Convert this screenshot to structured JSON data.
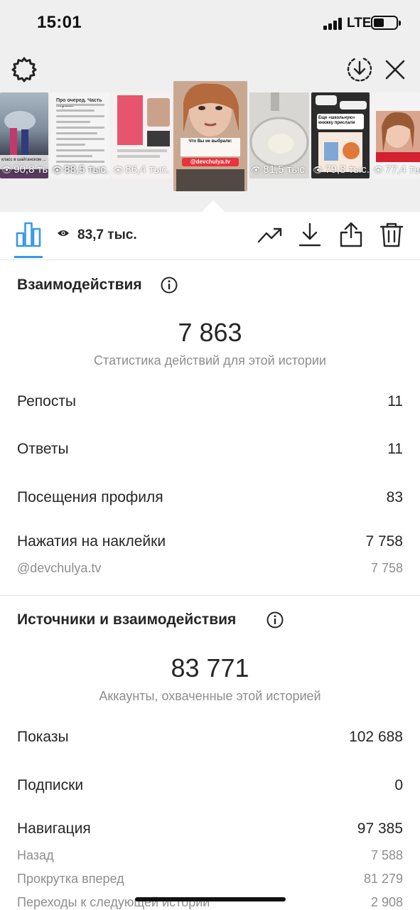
{
  "status_bar": {
    "time": "15:01",
    "network": "LTE"
  },
  "thumbnails": [
    {
      "views": "90,8 тыс.",
      "caption": "класс в шайтанском ...",
      "selected": false
    },
    {
      "views": "88,5 тыс.",
      "caption": "Про очеред. Часть первая",
      "selected": false
    },
    {
      "views": "86,4 тыс.",
      "caption": "",
      "selected": false
    },
    {
      "views": "83,7 тыс.",
      "caption": "Что Вы не выбрали:",
      "handle": "@devchulya.tv",
      "selected": true
    },
    {
      "views": "81,5 тыс.",
      "caption": "",
      "selected": false
    },
    {
      "views": "79,8 тыс.",
      "caption": "Еще «школьную» книжку прислали",
      "selected": false
    },
    {
      "views": "77,4 тыс.",
      "caption": "",
      "selected": false
    }
  ],
  "toolbar": {
    "view_count": "83,7 тыс."
  },
  "interactions": {
    "title": "Взаимодействия",
    "total": "7 863",
    "caption": "Статистика действий для этой истории",
    "rows": [
      {
        "label": "Репосты",
        "value": "11"
      },
      {
        "label": "Ответы",
        "value": "11"
      },
      {
        "label": "Посещения профиля",
        "value": "83"
      },
      {
        "label": "Нажатия на наклейки",
        "value": "7 758"
      }
    ],
    "sub_rows": [
      {
        "label": "@devchulya.tv",
        "value": "7 758"
      }
    ]
  },
  "discovery": {
    "title": "Источники и взаимодействия",
    "total": "83 771",
    "caption": "Аккаунты, охваченные этой историей",
    "rows": [
      {
        "label": "Показы",
        "value": "102 688"
      },
      {
        "label": "Подписки",
        "value": "0"
      },
      {
        "label": "Навигация",
        "value": "97 385"
      }
    ],
    "sub_rows": [
      {
        "label": "Назад",
        "value": "7 588"
      },
      {
        "label": "Прокрутка вперед",
        "value": "81 279"
      },
      {
        "label": "Переходы к следующей истории",
        "value": "2 908"
      }
    ]
  },
  "colors": {
    "accent": "#3897f0",
    "text": "#262626",
    "secondary": "#8e8e8e",
    "background_top": "#efefef"
  },
  "icons": {
    "settings": "gear-icon",
    "save": "download-circle-icon",
    "close": "close-icon",
    "chart": "bar-chart-icon",
    "views": "eye-icon",
    "promote": "trending-up-icon",
    "download": "download-icon",
    "share": "share-icon",
    "delete": "trash-icon",
    "info": "info-icon"
  }
}
